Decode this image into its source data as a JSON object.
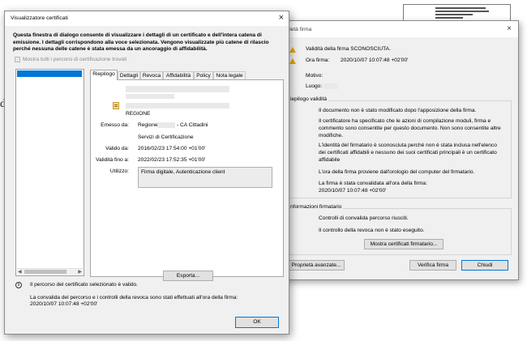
{
  "background_doc": {
    "letter": "d"
  },
  "signature_properties": {
    "title": "rietà firma",
    "close_glyph": "×",
    "validity_status": "Validità della firma SCONOSCIUTA.",
    "time_label": "Ora firma:",
    "time_value": "2020/10/07 10:07:48 +02'00'",
    "reason_label": "Motivo:",
    "location_label": "Luogo:",
    "validity_summary_title": "iepilogo validità",
    "validity_messages": [
      "Il documento non è stato modificato dopo l'apposizione della firma.",
      "Il certificatore ha specificato che le azioni di compilazione moduli, firma e commento sono consentite per questo documento. Non sono consentite altre modifiche.",
      "L'identità del firmatario è sconosciuta perché non è stata inclusa nell'elenco dei certificati affidabili e nessuno dei suoi certificati principali è un certificato affidabile",
      "L'ora della firma proviene dall'orologio del computer del firmatario.",
      "La firma è stata convalidata all'ora della firma:",
      "2020/10/07 10:07:48 +02'00'"
    ],
    "signer_info_title": "nformazioni firmatario",
    "signer_messages": [
      "Controlli di convalida percorso riusciti.",
      "Il controllo della revoca non è stato eseguito."
    ],
    "show_cert_button": "Mostra certificati firmatario...",
    "advanced_button": "Proprietà avanzate...",
    "verify_button": "Verifica firma",
    "close_button": "Chiudi"
  },
  "cert_viewer": {
    "title": "Visualizzatore certificati",
    "close_glyph": "×",
    "intro": "Questa finestra di dialogo consente di visualizzare i dettagli di un certificato e dell'intera catena di emissione. I dettagli corrispondono alla voce selezionata. Vengono visualizzate più catene di rilascio perché nessuna delle catene è stata emessa da un ancoraggio di affidabilità.",
    "show_all_paths": "Mostra tutti i percorsi di certificazione trovati",
    "tabs": [
      "Riepilogo",
      "Dettagli",
      "Revoca",
      "Affidabilità",
      "Policy",
      "Nota legale"
    ],
    "active_tab": "Riepilogo",
    "summary": {
      "subject_name": "REGIONE",
      "issued_by_label": "Emesso da:",
      "issued_by_org": "Regione",
      "issued_by_ca": "- CA Cittadini",
      "issued_by_unit": "Servizi di Certificazione",
      "valid_from_label": "Valido da:",
      "valid_from": "2016/02/23 17:54:00 +01'00'",
      "valid_to_label": "Validità fino a:",
      "valid_to": "2022/02/23 17:52:35 +01'00'",
      "usage_label": "Utilizzo:",
      "usage": "Firma digitale, Autenticazione client"
    },
    "export_button": "Esporta...",
    "status_line1": "Il percorso del certificato selezionato è valido.",
    "status_line2": "La convalida del percorso e i controlli della revoca sono stati effettuati all'ora della firma:",
    "status_line3": "2020/10/07 10:07:48 +02'00'",
    "ok_button": "OK",
    "scroll_left": "◀",
    "scroll_right": "▶",
    "info_glyph": "i"
  },
  "colors": {
    "selection": "#0078d7",
    "warning": "#e6a800",
    "dialog_bg": "#f0f0f0"
  }
}
